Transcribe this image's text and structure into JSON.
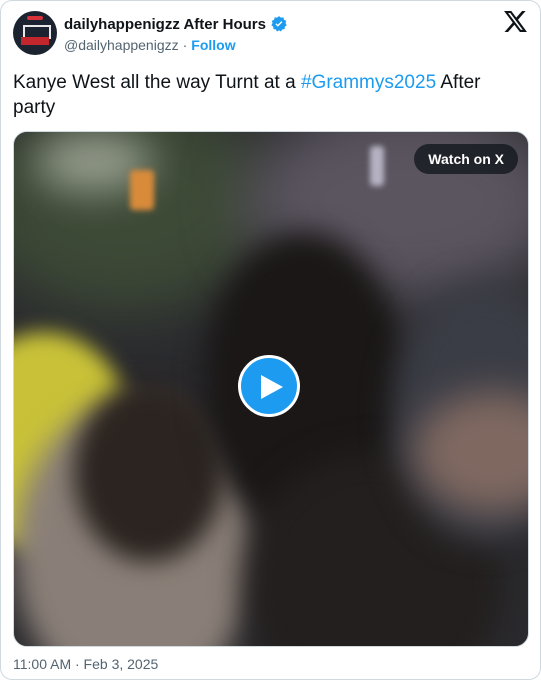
{
  "author": {
    "display_name": "dailyhappenigzz After Hours",
    "handle": "@dailyhappenigzz",
    "separator": "·",
    "follow_label": "Follow",
    "verified": true
  },
  "tweet": {
    "text_before": "Kanye West all the way Turnt at a ",
    "hashtag": "#Grammys2025",
    "text_after": " After party"
  },
  "media": {
    "watch_label": "Watch on X",
    "play_icon": "play-icon"
  },
  "footer": {
    "timestamp": "11:00 AM · Feb 3, 2025"
  },
  "colors": {
    "accent": "#1d9bf0",
    "text": "#0f1419",
    "secondary": "#536471"
  },
  "icons": [
    "verified-badge-icon",
    "x-logo-icon",
    "play-icon"
  ]
}
